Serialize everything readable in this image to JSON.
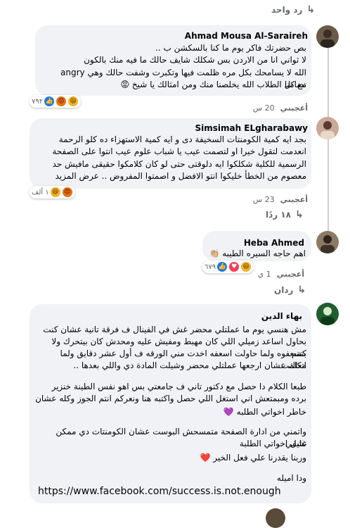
{
  "top_reply": {
    "label": "رد واحد"
  },
  "comments": [
    {
      "author": "Ahmad Mousa Al-Saraireh",
      "lines": [
        "بص حضرتك فاكر يوم ما كنا بالسكشن ب ..",
        "لا ثواني انا من الاردن بس شكلك شايف حالك ما فيه منك بالكون",
        "الله لا يسامحك بكل مره ظلمت فيها وتكبرت وشفت حالك وهي angry تضامنا",
        "مع كل الطلاب الله يخلصنا منك ومن امثالك يا شيخ 😡"
      ],
      "reaction_count": "٧٩٢",
      "like_label": "أعجبني",
      "time": "20 س"
    },
    {
      "author": "Simsimah ELgharabawy",
      "lines": [
        "بجد ايه كمية الكومنتات السخيفة دى و ايه كمية الاستهزاء ده كلو الرحمة",
        "انعدمت لتقول خيرا او لتصمت عيب يا شباب علوم عيب انتوا على الصفحة",
        "الرسمية للكلية شكلكوا ايه دلوقتى حتى لو كان كلامكوا حقيقى مافيش حد",
        "معصوم من الخطأ خليكوا انتو الافضل و اصمتوا المفروض .. عرض المزيد"
      ],
      "reaction_count": "١ ألف",
      "like_label": "أعجبني",
      "time": "23 س"
    },
    {
      "author": "Heba Ahmed",
      "lines": [
        "اهم حاجه السيره الطيبه 👏🏼"
      ],
      "reaction_count": "٦٧٩",
      "like_label": "أعجبني",
      "time": "1 ي"
    },
    {
      "author": "بهاء الدين",
      "lines": [
        "مش هنسي يوم ما عملتلي محضر غش في الفينال ف فرقة تانية عشان كنت",
        "بحاول اساعد زميلي اللي كان مهبط ومفيش عليه ومحدش كان بيتحرك ولا كنتم",
        "بتسعفوه ولما حاولت اسعفه اخدت مني الورقه ف أول عشر دقايق ولما اتكلمت",
        "معاك عشان ارجعها عملتلي محضر وشيلت المادة دي واللي بعدها ..",
        "",
        "طبعا الكلام دا حصل مع دكتور تاني ف جامعتي بس اهو نفس الطينة خنزير",
        "برده ومبمتعش اني استغل اللي حصل واكتبه هنا ونعركم انتم الجوز وكله عشان",
        "خاطر اخواتي الطلبه 💜",
        "",
        "واتمني من ادارة الصفحة متمسحش البوست عشان الكومنتات دي ممكن تشفي",
        "غليل اخواتي الطلبة",
        "وربنا يقدرنا علي فعل الخير ❤️",
        "",
        "ودا اميله"
      ],
      "link": "https://www.facebook.com/success.is.not.enough"
    }
  ],
  "replies_summary": {
    "label": "١٨ ردًا"
  },
  "replies_label": {
    "label": "ردان"
  }
}
